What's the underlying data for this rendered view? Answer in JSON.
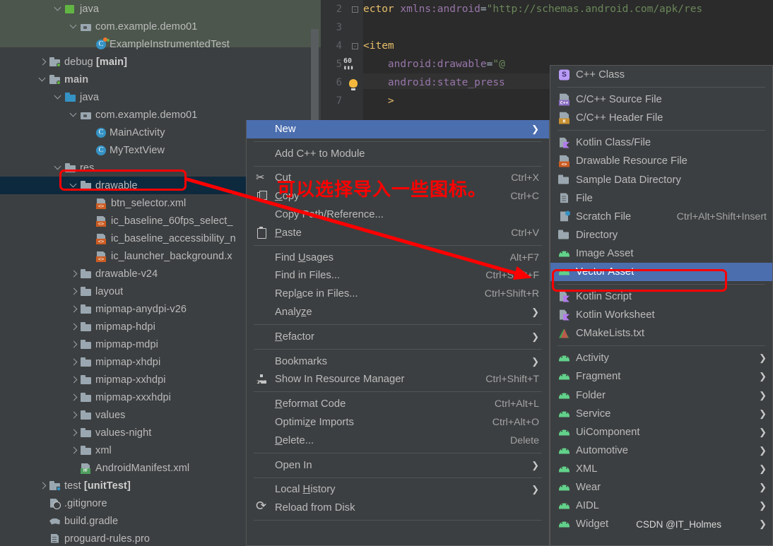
{
  "editor": {
    "lines": [
      {
        "no": "2",
        "segments": [
          {
            "t": "ector ",
            "c": "tag"
          },
          {
            "t": "xmlns:android",
            "c": "ns"
          },
          {
            "t": "=",
            "c": "eq"
          },
          {
            "t": "\"http://schemas.android.com/apk/res",
            "c": "str"
          }
        ],
        "fold": true
      },
      {
        "no": "3",
        "segments": []
      },
      {
        "no": "4",
        "segments": [
          {
            "t": "<item",
            "c": "tag"
          }
        ],
        "fold": true
      },
      {
        "no": "5",
        "segments": [
          {
            "t": "    ",
            "c": "eq"
          },
          {
            "t": "android:drawable",
            "c": "ns"
          },
          {
            "t": "=",
            "c": "eq"
          },
          {
            "t": "\"@",
            "c": "str"
          }
        ],
        "marker": "60fps"
      },
      {
        "no": "6",
        "segments": [
          {
            "t": "    ",
            "c": "eq"
          },
          {
            "t": "android:state_press",
            "c": "ns"
          }
        ],
        "marker": "bulb"
      },
      {
        "no": "7",
        "segments": [
          {
            "t": "    >",
            "c": "tag"
          }
        ]
      }
    ]
  },
  "tree": {
    "items": [
      {
        "label": "java",
        "indent": 3,
        "arrow": "down",
        "icon": "folder-green-sq",
        "bold": false,
        "band": true
      },
      {
        "label": "com.example.demo01",
        "indent": 4,
        "arrow": "down",
        "icon": "pkg",
        "bold": false,
        "band": true
      },
      {
        "label": "ExampleInstrumentedTest",
        "indent": 5,
        "arrow": "none",
        "icon": "class-test",
        "bold": false,
        "band": true
      },
      {
        "label": "debug ",
        "bold_suffix": "[main]",
        "indent": 2,
        "arrow": "right",
        "icon": "folder-dot"
      },
      {
        "label": "main",
        "indent": 2,
        "arrow": "down",
        "icon": "folder-dot",
        "bold": true
      },
      {
        "label": "java",
        "indent": 3,
        "arrow": "down",
        "icon": "folder-blue"
      },
      {
        "label": "com.example.demo01",
        "indent": 4,
        "arrow": "down",
        "icon": "pkg"
      },
      {
        "label": "MainActivity",
        "indent": 5,
        "arrow": "none",
        "icon": "class"
      },
      {
        "label": "MyTextView",
        "indent": 5,
        "arrow": "none",
        "icon": "class"
      },
      {
        "label": "res",
        "indent": 3,
        "arrow": "down",
        "icon": "folder-res"
      },
      {
        "label": "drawable",
        "indent": 4,
        "arrow": "down",
        "icon": "folder",
        "selected": true
      },
      {
        "label": "btn_selector.xml",
        "indent": 5,
        "arrow": "none",
        "icon": "xml"
      },
      {
        "label": "ic_baseline_60fps_select_",
        "indent": 5,
        "arrow": "none",
        "icon": "xml"
      },
      {
        "label": "ic_baseline_accessibility_n",
        "indent": 5,
        "arrow": "none",
        "icon": "xml"
      },
      {
        "label": "ic_launcher_background.x",
        "indent": 5,
        "arrow": "none",
        "icon": "xml"
      },
      {
        "label": "drawable-v24",
        "indent": 4,
        "arrow": "right",
        "icon": "folder"
      },
      {
        "label": "layout",
        "indent": 4,
        "arrow": "right",
        "icon": "folder"
      },
      {
        "label": "mipmap-anydpi-v26",
        "indent": 4,
        "arrow": "right",
        "icon": "folder"
      },
      {
        "label": "mipmap-hdpi",
        "indent": 4,
        "arrow": "right",
        "icon": "folder"
      },
      {
        "label": "mipmap-mdpi",
        "indent": 4,
        "arrow": "right",
        "icon": "folder"
      },
      {
        "label": "mipmap-xhdpi",
        "indent": 4,
        "arrow": "right",
        "icon": "folder"
      },
      {
        "label": "mipmap-xxhdpi",
        "indent": 4,
        "arrow": "right",
        "icon": "folder"
      },
      {
        "label": "mipmap-xxxhdpi",
        "indent": 4,
        "arrow": "right",
        "icon": "folder"
      },
      {
        "label": "values",
        "indent": 4,
        "arrow": "right",
        "icon": "folder"
      },
      {
        "label": "values-night",
        "indent": 4,
        "arrow": "right",
        "icon": "folder"
      },
      {
        "label": "xml",
        "indent": 4,
        "arrow": "right",
        "icon": "folder"
      },
      {
        "label": "AndroidManifest.xml",
        "indent": 4,
        "arrow": "none",
        "icon": "mf"
      },
      {
        "label": "test ",
        "bold_suffix": "[unitTest]",
        "indent": 2,
        "arrow": "right",
        "icon": "folder-dot-blue"
      },
      {
        "label": ".gitignore",
        "indent": 2,
        "arrow": "none",
        "icon": "gitignore"
      },
      {
        "label": "build.gradle",
        "indent": 2,
        "arrow": "none",
        "icon": "gradle"
      },
      {
        "label": "proguard-rules.pro",
        "indent": 2,
        "arrow": "none",
        "icon": "txt"
      }
    ]
  },
  "context_menu": {
    "items": [
      {
        "label": "New",
        "submenu": true,
        "highlighted": true,
        "mnemonic": ""
      },
      {
        "sep": true
      },
      {
        "label": "Add C++ to Module"
      },
      {
        "sep": true
      },
      {
        "label": "Cut",
        "mnemonic": "t",
        "shortcut": "Ctrl+X",
        "icon": "cut-icon"
      },
      {
        "label": "Copy",
        "mnemonic": "C",
        "shortcut": "Ctrl+C",
        "icon": "copy-icon"
      },
      {
        "label": "Copy Path/Reference..."
      },
      {
        "label": "Paste",
        "mnemonic": "P",
        "shortcut": "Ctrl+V",
        "icon": "paste-icon"
      },
      {
        "sep": true
      },
      {
        "label": "Find Usages",
        "mnemonic": "U",
        "shortcut": "Alt+F7"
      },
      {
        "label": "Find in Files...",
        "shortcut": "Ctrl+Shift+F"
      },
      {
        "label": "Replace in Files...",
        "mnemonic": "a",
        "shortcut": "Ctrl+Shift+R"
      },
      {
        "label": "Analyze",
        "mnemonic": "z",
        "submenu": true
      },
      {
        "sep": true
      },
      {
        "label": "Refactor",
        "mnemonic": "R",
        "submenu": true
      },
      {
        "sep": true
      },
      {
        "label": "Bookmarks",
        "submenu": true
      },
      {
        "label": "Show In Resource Manager",
        "shortcut": "Ctrl+Shift+T",
        "icon": "resource-manager-icon"
      },
      {
        "sep": true
      },
      {
        "label": "Reformat Code",
        "mnemonic": "R",
        "shortcut": "Ctrl+Alt+L"
      },
      {
        "label": "Optimize Imports",
        "mnemonic": "z",
        "shortcut": "Ctrl+Alt+O"
      },
      {
        "label": "Delete...",
        "mnemonic": "D",
        "shortcut": "Delete"
      },
      {
        "sep": true
      },
      {
        "label": "Open In",
        "submenu": true
      },
      {
        "sep": true
      },
      {
        "label": "Local History",
        "mnemonic": "H",
        "submenu": true
      },
      {
        "label": "Reload from Disk",
        "icon": "reload-icon"
      },
      {
        "sep": true
      }
    ]
  },
  "sub_menu": {
    "items": [
      {
        "label": "C++ Class",
        "icon": "cpp-class-icon"
      },
      {
        "sep": true
      },
      {
        "label": "C/C++ Source File",
        "icon": "cpp-source-icon"
      },
      {
        "label": "C/C++ Header File",
        "icon": "cpp-header-icon"
      },
      {
        "sep": true
      },
      {
        "label": "Kotlin Class/File",
        "icon": "kotlin-icon"
      },
      {
        "label": "Drawable Resource File",
        "icon": "drawable-resource-icon"
      },
      {
        "label": "Sample Data Directory",
        "icon": "folder-icon"
      },
      {
        "label": "File",
        "icon": "file-icon"
      },
      {
        "label": "Scratch File",
        "icon": "scratch-file-icon",
        "shortcut": "Ctrl+Alt+Shift+Insert"
      },
      {
        "label": "Directory",
        "icon": "folder-icon"
      },
      {
        "label": "Image Asset",
        "icon": "android-icon"
      },
      {
        "label": "Vector Asset",
        "icon": "android-icon",
        "highlighted": true
      },
      {
        "sep": true
      },
      {
        "label": "Kotlin Script",
        "icon": "kotlin-icon"
      },
      {
        "label": "Kotlin Worksheet",
        "icon": "kotlin-icon"
      },
      {
        "label": "CMakeLists.txt",
        "icon": "cmake-icon"
      },
      {
        "sep": true
      },
      {
        "label": "Activity",
        "icon": "android-icon",
        "submenu": true
      },
      {
        "label": "Fragment",
        "icon": "android-icon",
        "submenu": true
      },
      {
        "label": "Folder",
        "icon": "android-icon",
        "submenu": true
      },
      {
        "label": "Service",
        "icon": "android-icon",
        "submenu": true
      },
      {
        "label": "UiComponent",
        "icon": "android-icon",
        "submenu": true
      },
      {
        "label": "Automotive",
        "icon": "android-icon",
        "submenu": true
      },
      {
        "label": "XML",
        "icon": "android-icon",
        "submenu": true
      },
      {
        "label": "Wear",
        "icon": "android-icon",
        "submenu": true
      },
      {
        "label": "AIDL",
        "icon": "android-icon",
        "submenu": true
      },
      {
        "label": "Widget",
        "icon": "android-icon",
        "submenu": true
      }
    ]
  },
  "annotations": {
    "note_text": "可以选择导入一些图标。",
    "note_color": "#ff0000",
    "watermark": "CSDN @IT_Holmes",
    "highlight_boxes": [
      "drawable-tree-row",
      "vector-asset-menu-item"
    ]
  }
}
